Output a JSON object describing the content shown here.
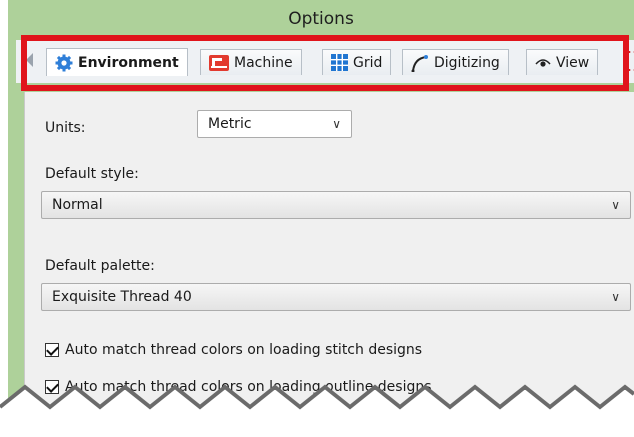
{
  "window": {
    "title": "Options"
  },
  "tabs": [
    {
      "label": "Environment",
      "icon": "gear-icon",
      "active": true
    },
    {
      "label": "Machine",
      "icon": "sewing-machine-icon",
      "active": false
    },
    {
      "label": "Grid",
      "icon": "grid-icon",
      "active": false
    },
    {
      "label": "Digitizing",
      "icon": "digitizing-curve-icon",
      "active": false
    },
    {
      "label": "View",
      "icon": "eye-icon",
      "active": false
    }
  ],
  "units": {
    "label": "Units:",
    "value": "Metric"
  },
  "default_style": {
    "label": "Default style:",
    "value": "Normal"
  },
  "default_palette": {
    "label": "Default palette:",
    "value": "Exquisite Thread 40"
  },
  "checkboxes": [
    {
      "label": "Auto match thread colors on loading stitch designs",
      "checked": true
    },
    {
      "label": "Auto match thread colors on loading outline designs",
      "checked": true
    }
  ],
  "colors": {
    "window_bg": "#aed19a",
    "highlight": "#e0141b",
    "panel_bg": "#f0f0f0"
  }
}
